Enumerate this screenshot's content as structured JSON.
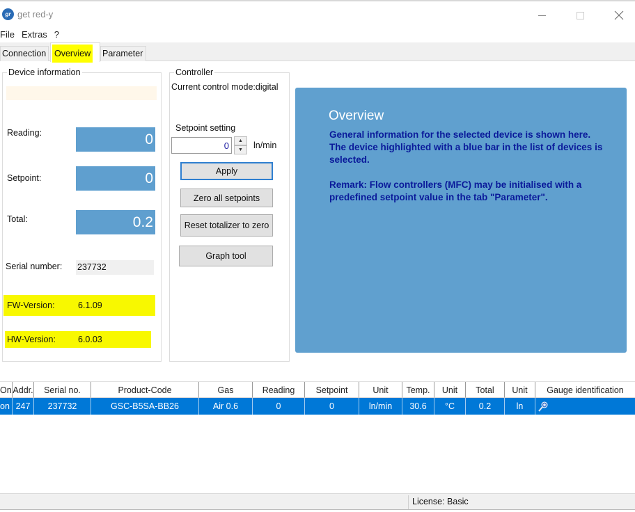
{
  "window": {
    "title": "get red-y",
    "app_icon_text": "gr"
  },
  "menu": [
    "File",
    "Extras",
    "?"
  ],
  "tabs": [
    {
      "label": "Connection",
      "active": false
    },
    {
      "label": "Overview",
      "active": true,
      "highlighted": true
    },
    {
      "label": "Parameter",
      "active": false
    }
  ],
  "device_info": {
    "title": "Device information",
    "reading_label": "Reading:",
    "reading_value": "0",
    "setpoint_label": "Setpoint:",
    "setpoint_value": "0",
    "total_label": "Total:",
    "total_value": "0.2",
    "serial_label": "Serial number:",
    "serial_value": "237732",
    "fw_label": "FW-Version:",
    "fw_value": "6.1.09",
    "hw_label": "HW-Version:",
    "hw_value": "6.0.03"
  },
  "controller": {
    "title": "Controller",
    "mode_text": "Current control mode:digital",
    "setpoint_setting_label": "Setpoint setting",
    "setpoint_input_value": "0",
    "setpoint_unit": "ln/min",
    "apply_label": "Apply",
    "zero_label": "Zero all setpoints",
    "reset_label": "Reset totalizer to zero",
    "graph_label": "Graph tool"
  },
  "help": {
    "title": "Overview",
    "line1": "General information for the selected device is shown here.",
    "line2": "The device highlighted with a blue bar in the list of devices is selected.",
    "remark": "Remark: Flow controllers (MFC) may be initialised with a predefined setpoint value in the tab \"Parameter\"."
  },
  "device_table": {
    "columns": [
      "On",
      "Addr.",
      "Serial no.",
      "Product-Code",
      "Gas",
      "Reading",
      "Setpoint",
      "Unit",
      "Temp.",
      "Unit",
      "Total",
      "Unit",
      "Gauge identification"
    ],
    "rows": [
      [
        "on",
        "247",
        "237732",
        "GSC-B5SA-BB26",
        "Air 0.6",
        "0",
        "0",
        "ln/min",
        "30.6",
        "°C",
        "0.2",
        "ln",
        ""
      ]
    ]
  },
  "status": {
    "license": "License: Basic"
  },
  "colors": {
    "accent_blue": "#0078d7",
    "value_blue": "#5f9fcf",
    "highlight_yellow": "#ffff00",
    "help_text": "#0a1a9a"
  }
}
